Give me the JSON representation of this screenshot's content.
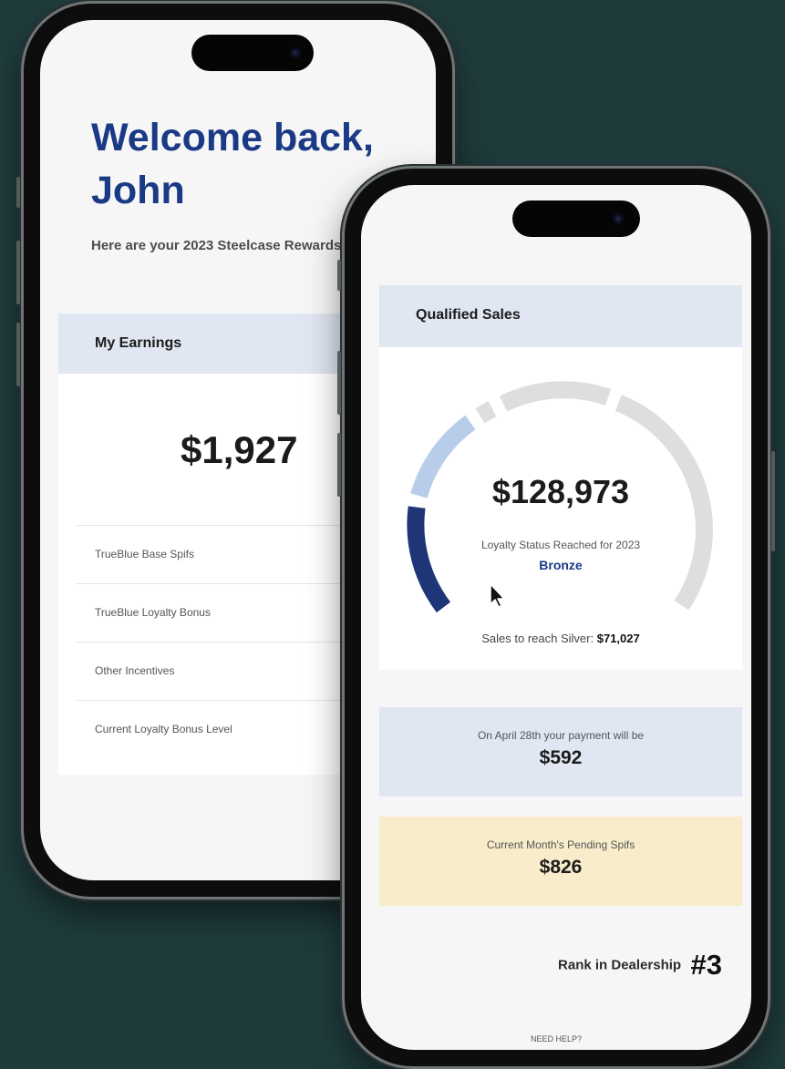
{
  "earnings_screen": {
    "welcome_title": "Welcome back, John",
    "subtitle": "Here are your 2023 Steelcase Rewards",
    "section_title": "My Earnings",
    "total": "$1,927",
    "items": [
      {
        "label": "TrueBlue Base Spifs"
      },
      {
        "label": "TrueBlue Loyalty Bonus"
      },
      {
        "label": "Other Incentives"
      },
      {
        "label": "Current Loyalty Bonus Level"
      }
    ]
  },
  "sales_screen": {
    "section_title": "Qualified Sales",
    "amount": "$128,973",
    "status_label": "Loyalty Status Reached for 2023",
    "tier": "Bronze",
    "silver_label": "Sales to reach Silver:",
    "silver_amount": "$71,027",
    "payment_label": "On April 28th your payment will be",
    "payment_amount": "$592",
    "pending_label": "Current Month's Pending Spifs",
    "pending_amount": "$826",
    "rank_label": "Rank in Dealership",
    "rank_value": "#3",
    "help_link": "NEED HELP?"
  },
  "colors": {
    "background": "#1f3c3d",
    "brand_navy": "#1a3a86",
    "gauge_fill": "#1e3678",
    "gauge_light": "#b8cdea",
    "gauge_track": "#dedede",
    "panel_blue": "#e0e6f2",
    "panel_yellow": "#f8eccb"
  },
  "icons": [
    "pointer-cursor-icon"
  ]
}
